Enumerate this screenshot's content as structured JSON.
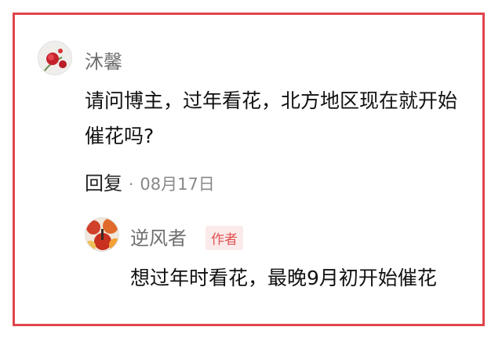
{
  "comment": {
    "author": "沐馨",
    "avatar_icon": "rose-flower-avatar",
    "text": "请问博主，过年看花，北方地区现在就开始催花吗?",
    "reply_label": "回复",
    "separator": "·",
    "date": "08月17日"
  },
  "reply": {
    "author": "逆风者",
    "avatar_icon": "autumn-foliage-avatar",
    "badge": "作者",
    "text": "想过年时看花，最晚9月初开始催花"
  },
  "colors": {
    "frame": "#e0454b",
    "badge_bg": "#fbeaea",
    "badge_text": "#e05252",
    "name": "#6f6f6f"
  }
}
